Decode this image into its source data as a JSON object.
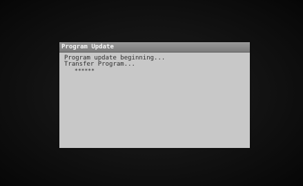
{
  "dialog": {
    "title": "Program Update",
    "lines": [
      "Program update beginning...",
      "Transfer Program..."
    ],
    "progress_indicator": "******"
  }
}
